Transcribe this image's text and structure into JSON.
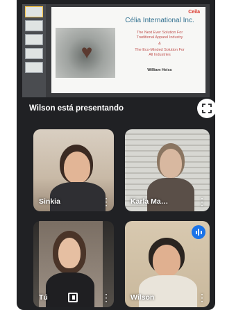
{
  "presentation": {
    "slide": {
      "logo": "Ceila",
      "company": "Célia International Inc.",
      "lines": [
        "The Next Ever Solution For",
        "Traditional Apparel Industry",
        "&",
        "The Eco-Minded Solution For",
        "All Industries"
      ],
      "presenter": "William Heiss"
    },
    "thumbnail_count": 5
  },
  "presenting_label": "Wilson está presentando",
  "participants": [
    {
      "name": "Sinkia"
    },
    {
      "name": "Karla Ma…"
    },
    {
      "name": "Tú"
    },
    {
      "name": "Wilson"
    }
  ],
  "colors": {
    "background": "#202124",
    "speaking_indicator": "#1a73e8"
  }
}
